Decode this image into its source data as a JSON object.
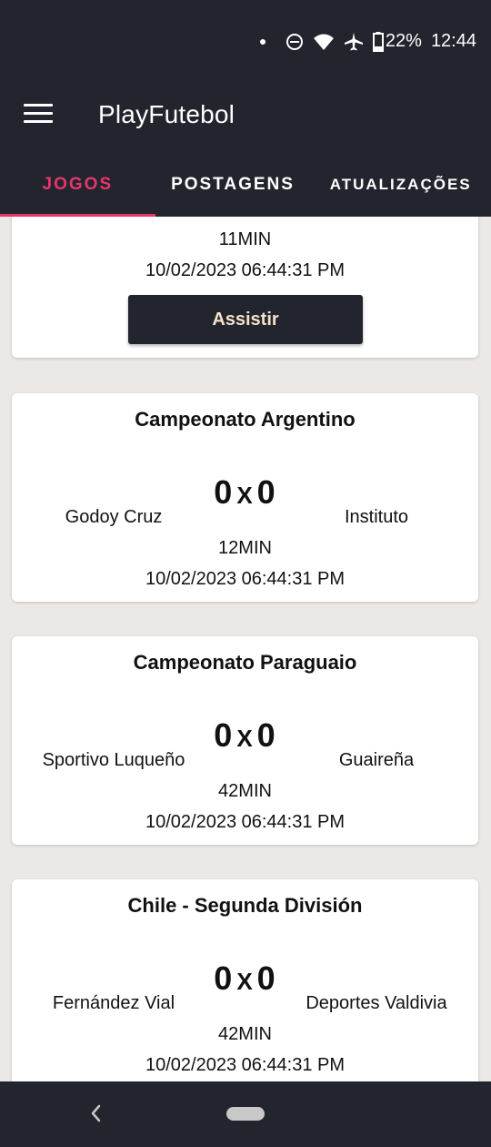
{
  "status": {
    "battery": "22%",
    "time": "12:44"
  },
  "app": {
    "title": "PlayFutebol"
  },
  "tabs": [
    {
      "label": "JOGOS",
      "active": true
    },
    {
      "label": "POSTAGENS",
      "active": false
    },
    {
      "label": "ATUALIZAÇÕES",
      "active": false
    }
  ],
  "partial_card": {
    "minute": "11MIN",
    "datetime": "10/02/2023 06:44:31 PM",
    "button": "Assistir"
  },
  "matches": [
    {
      "league": "Campeonato Argentino",
      "home": "Godoy Cruz",
      "away": "Instituto",
      "home_score": "0",
      "separator": "X",
      "away_score": "0",
      "minute": "12MIN",
      "datetime": "10/02/2023 06:44:31 PM"
    },
    {
      "league": "Campeonato Paraguaio",
      "home": "Sportivo Luqueño",
      "away": "Guaireña",
      "home_score": "0",
      "separator": "X",
      "away_score": "0",
      "minute": "42MIN",
      "datetime": "10/02/2023 06:44:31 PM"
    },
    {
      "league": "Chile - Segunda División",
      "home": "Fernández Vial",
      "away": "Deportes Valdivia",
      "home_score": "0",
      "separator": "X",
      "away_score": "0",
      "minute": "42MIN",
      "datetime": "10/02/2023 06:44:31 PM"
    }
  ],
  "icons": {
    "menu": "hamburger-menu-icon",
    "dnd": "do-not-disturb-icon",
    "wifi": "wifi-icon",
    "airplane": "airplane-icon",
    "battery": "battery-icon",
    "back": "back-icon",
    "home": "home-pill-icon"
  },
  "colors": {
    "bar": "#23252e",
    "accent": "#e8356b",
    "background": "#ece8e6"
  }
}
